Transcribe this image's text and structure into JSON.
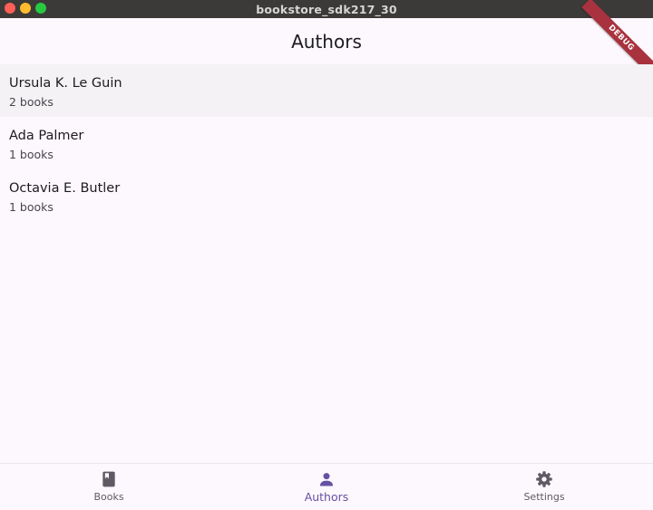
{
  "window": {
    "title": "bookstore_sdk217_30"
  },
  "appbar": {
    "title": "Authors"
  },
  "debug_banner": {
    "label": "DEBUG"
  },
  "authors": [
    {
      "name": "Ursula K. Le Guin",
      "count": "2 books",
      "selected": true
    },
    {
      "name": "Ada Palmer",
      "count": "1 books",
      "selected": false
    },
    {
      "name": "Octavia E. Butler",
      "count": "1 books",
      "selected": false
    }
  ],
  "bottom_nav": {
    "items": [
      {
        "label": "Books",
        "icon": "book-icon",
        "active": false
      },
      {
        "label": "Authors",
        "icon": "person-icon",
        "active": true
      },
      {
        "label": "Settings",
        "icon": "gear-icon",
        "active": false
      }
    ]
  },
  "colors": {
    "accent": "#6750a4",
    "background": "#fdf8fd",
    "selected_row": "#f4f2f5",
    "titlebar": "#3b3a38"
  }
}
